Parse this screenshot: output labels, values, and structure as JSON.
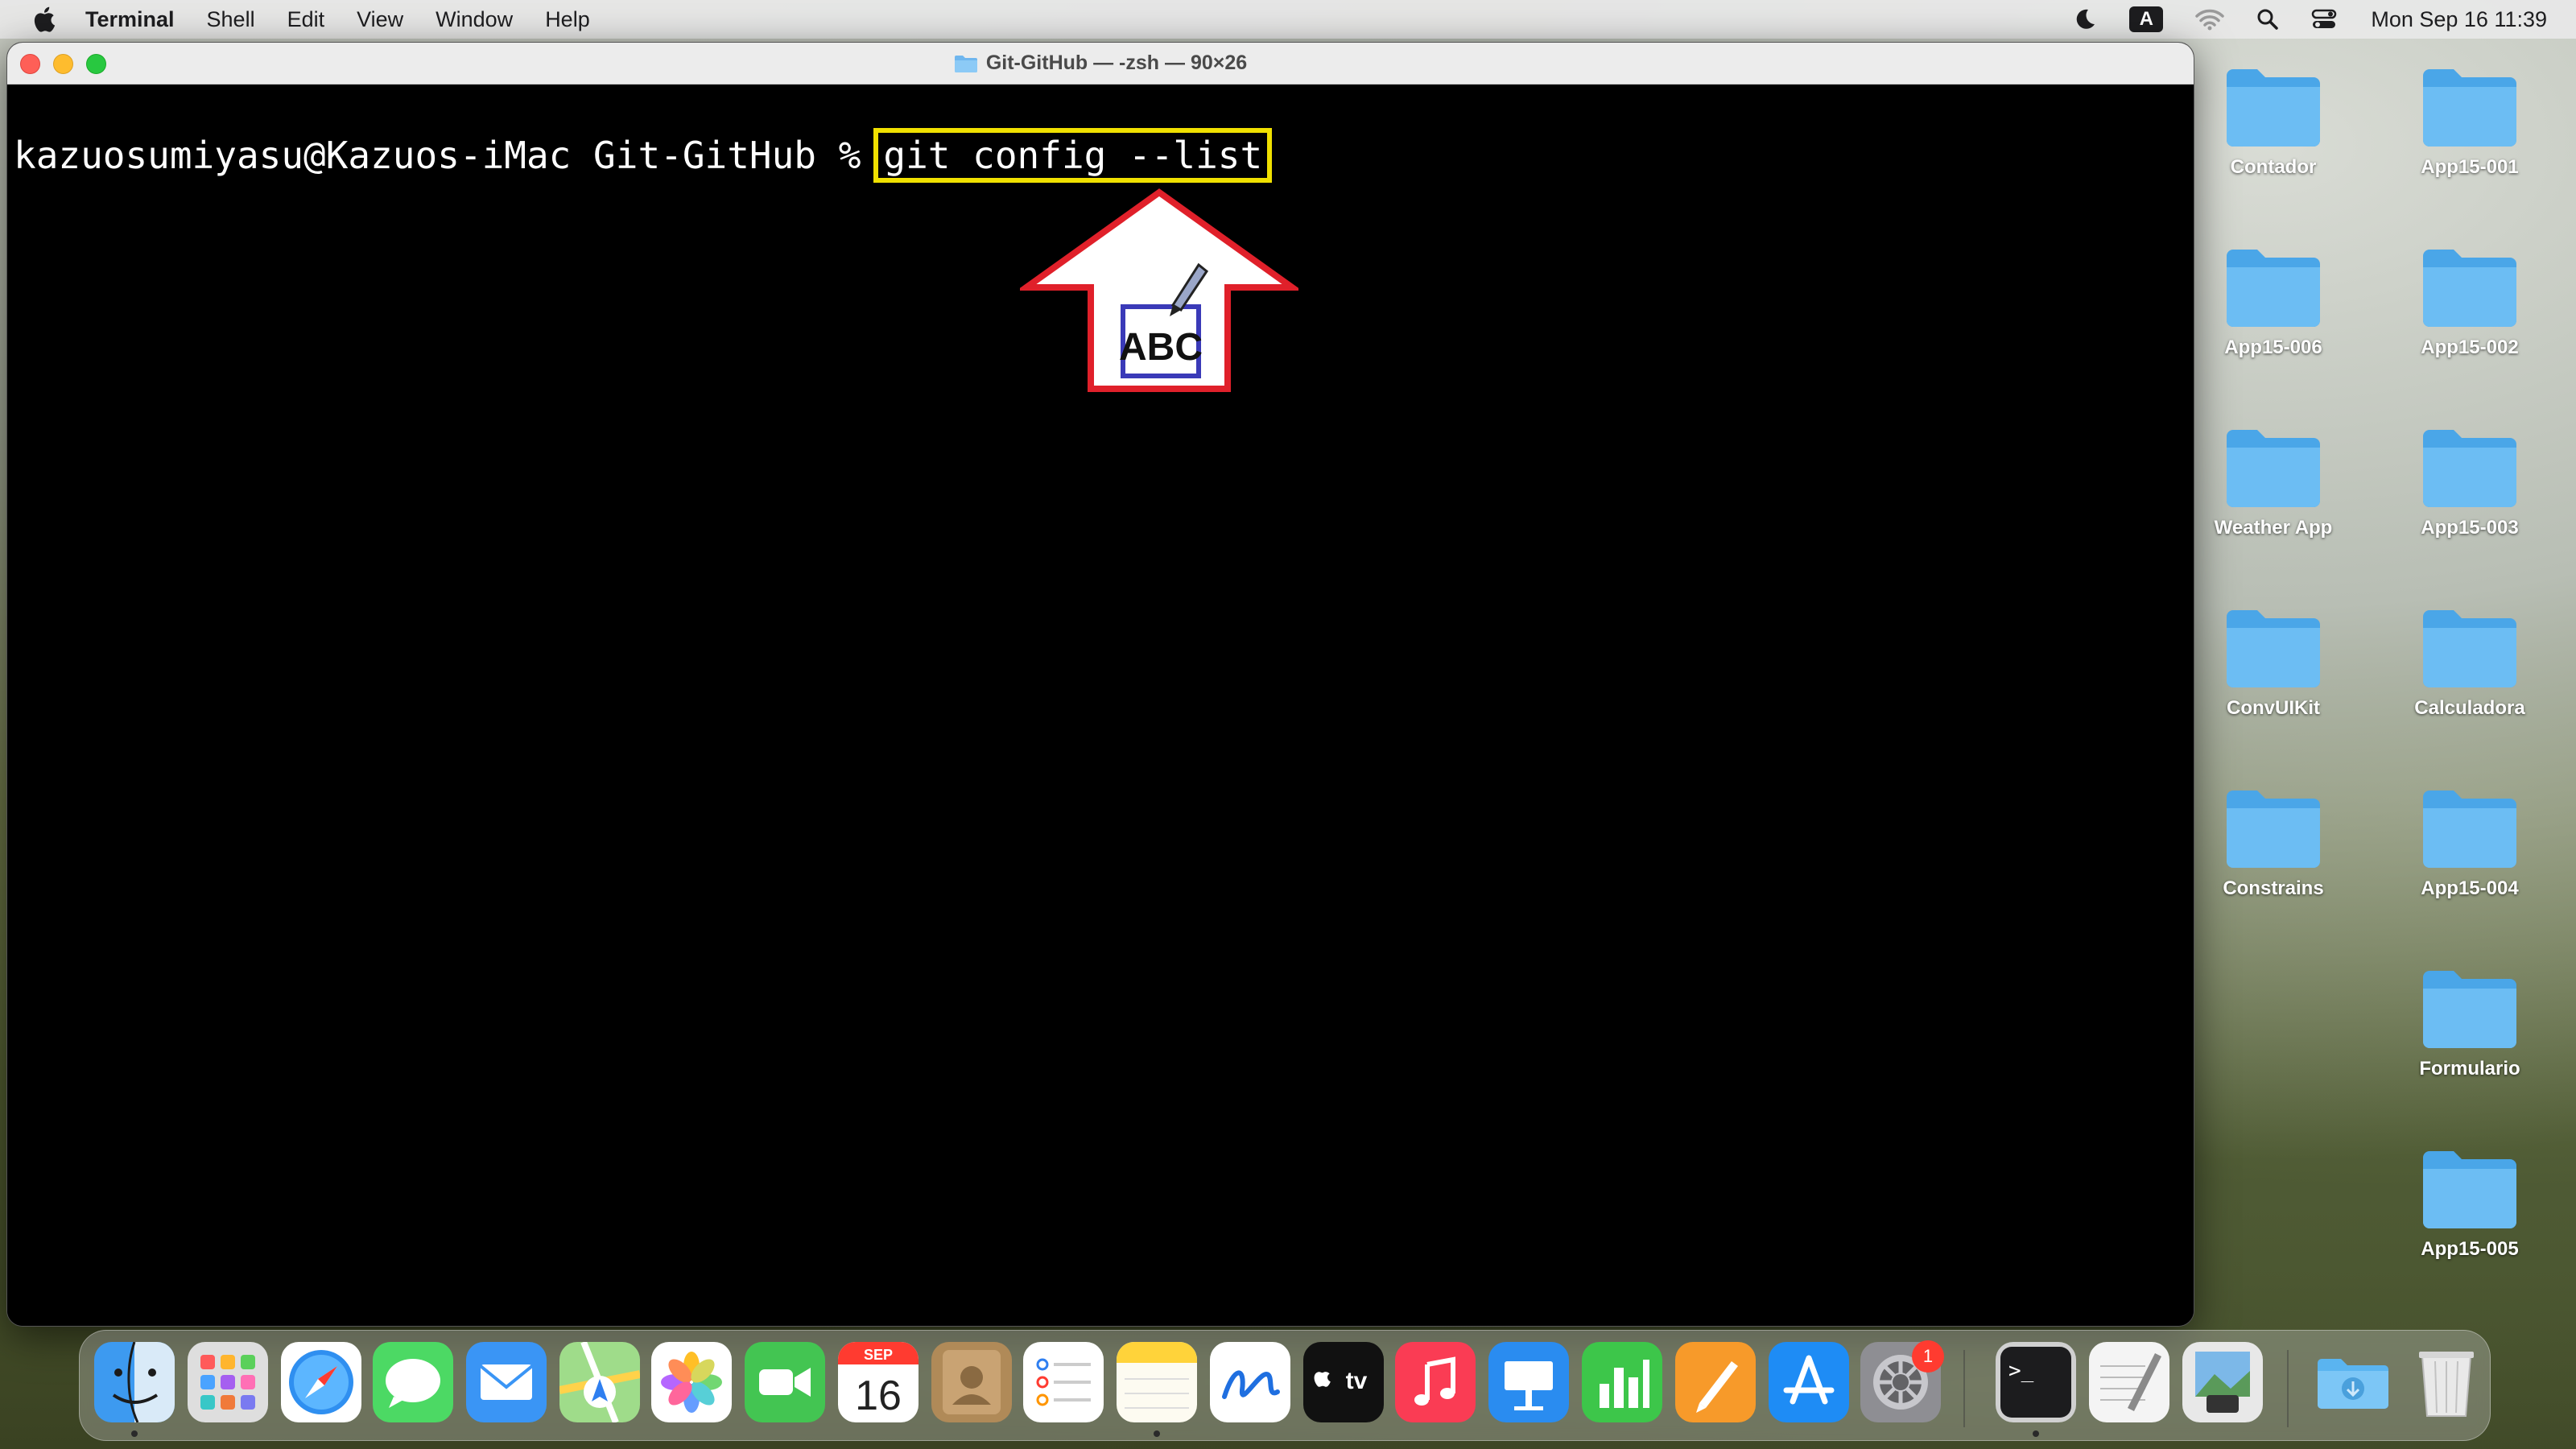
{
  "menubar": {
    "app_name": "Terminal",
    "items": [
      "Shell",
      "Edit",
      "View",
      "Window",
      "Help"
    ],
    "input_source": "A",
    "clock": "Mon Sep 16  11:39"
  },
  "terminal": {
    "window_title": "Git-GitHub — -zsh — 90×26",
    "prompt": "kazuosumiyasu@Kazuos-iMac Git-GitHub %",
    "command": "git config --list",
    "annotation_label": "ABC"
  },
  "desktop": {
    "icons": [
      "Contador",
      "App15-001",
      "App15-006",
      "App15-002",
      "Weather App",
      "App15-003",
      "ConvUIKit",
      "Calculadora",
      "Constrains",
      "App15-004",
      "Formulario",
      "App15-005"
    ]
  },
  "dock": {
    "calendar_month": "SEP",
    "calendar_day": "16",
    "tv_label": "tv",
    "settings_badge": "1",
    "terminal_glyph": ">_"
  },
  "colors": {
    "highlight": "#f0e000",
    "arrow": "#e0202a",
    "folder": "#5ab4f0"
  }
}
